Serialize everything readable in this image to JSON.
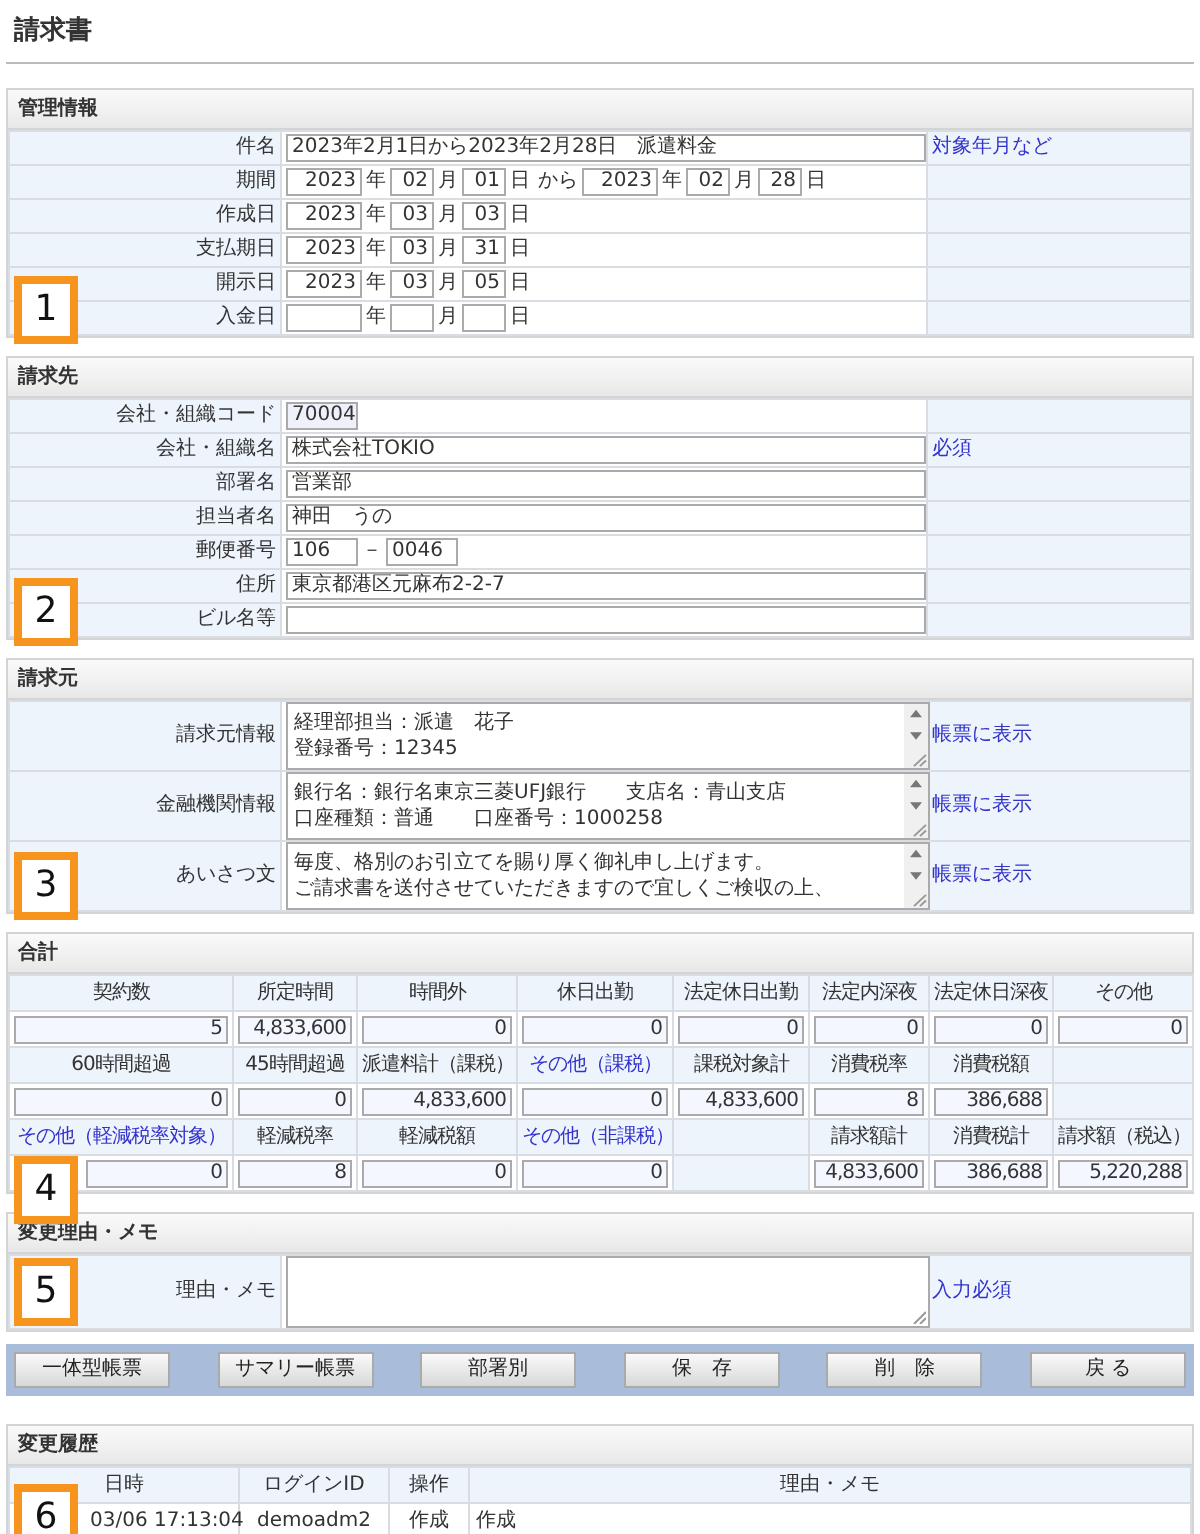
{
  "page_title": "請求書",
  "sections": [
    {
      "kind": "form",
      "heading": "管理情報",
      "callout": "1",
      "rows": [
        {
          "label": "件名",
          "fields": [
            {
              "kind": "wide",
              "value": "2023年2月1日から2023年2月28日　派遣料金"
            }
          ],
          "note": "対象年月など"
        },
        {
          "label": "期間",
          "fields": [
            {
              "kind": "year",
              "value": "2023"
            },
            {
              "kind": "unit",
              "text": "年"
            },
            {
              "kind": "short",
              "value": "02"
            },
            {
              "kind": "unit",
              "text": "月"
            },
            {
              "kind": "short",
              "value": "01"
            },
            {
              "kind": "unit",
              "text": "日"
            },
            {
              "kind": "unit",
              "text": "から"
            },
            {
              "kind": "year",
              "value": "2023"
            },
            {
              "kind": "unit",
              "text": "年"
            },
            {
              "kind": "short",
              "value": "02"
            },
            {
              "kind": "unit",
              "text": "月"
            },
            {
              "kind": "short",
              "value": "28"
            },
            {
              "kind": "unit",
              "text": "日"
            }
          ]
        },
        {
          "label": "作成日",
          "fields": [
            {
              "kind": "year",
              "value": "2023"
            },
            {
              "kind": "unit",
              "text": "年"
            },
            {
              "kind": "short",
              "value": "03"
            },
            {
              "kind": "unit",
              "text": "月"
            },
            {
              "kind": "short",
              "value": "03"
            },
            {
              "kind": "unit",
              "text": "日"
            }
          ]
        },
        {
          "label": "支払期日",
          "fields": [
            {
              "kind": "year",
              "value": "2023"
            },
            {
              "kind": "unit",
              "text": "年"
            },
            {
              "kind": "short",
              "value": "03"
            },
            {
              "kind": "unit",
              "text": "月"
            },
            {
              "kind": "short",
              "value": "31"
            },
            {
              "kind": "unit",
              "text": "日"
            }
          ]
        },
        {
          "label": "開示日",
          "fields": [
            {
              "kind": "year",
              "value": "2023"
            },
            {
              "kind": "unit",
              "text": "年"
            },
            {
              "kind": "short",
              "value": "03"
            },
            {
              "kind": "unit",
              "text": "月"
            },
            {
              "kind": "short",
              "value": "05"
            },
            {
              "kind": "unit",
              "text": "日"
            }
          ]
        },
        {
          "label": "入金日",
          "fields": [
            {
              "kind": "year"
            },
            {
              "kind": "unit",
              "text": "年"
            },
            {
              "kind": "short"
            },
            {
              "kind": "unit",
              "text": "月"
            },
            {
              "kind": "short"
            },
            {
              "kind": "unit",
              "text": "日"
            }
          ]
        }
      ]
    },
    {
      "kind": "form",
      "heading": "請求先",
      "callout": "2",
      "rows": [
        {
          "label": "会社・組織コード",
          "fields": [
            {
              "kind": "code",
              "value": "70004",
              "readonly": true
            }
          ]
        },
        {
          "label": "会社・組織名",
          "fields": [
            {
              "kind": "wide",
              "value": "株式会社TOKIO"
            }
          ],
          "note": "必須"
        },
        {
          "label": "部署名",
          "fields": [
            {
              "kind": "wide",
              "value": "営業部"
            }
          ]
        },
        {
          "label": "担当者名",
          "fields": [
            {
              "kind": "wide",
              "value": "神田　うの"
            }
          ]
        },
        {
          "label": "郵便番号",
          "fields": [
            {
              "kind": "code",
              "value": "106"
            },
            {
              "kind": "unit",
              "text": "－"
            },
            {
              "kind": "code",
              "value": "0046"
            }
          ]
        },
        {
          "label": "住所",
          "fields": [
            {
              "kind": "wide",
              "value": "東京都港区元麻布2-2-7"
            }
          ]
        },
        {
          "label": "ビル名等",
          "fields": [
            {
              "kind": "wide"
            }
          ]
        }
      ]
    },
    {
      "kind": "memo",
      "heading": "請求元",
      "callout": "3",
      "rows": [
        {
          "label": "請求元情報",
          "lines": [
            "経理部担当：派遣　花子",
            "登録番号：12345"
          ],
          "note": "帳票に表示"
        },
        {
          "label": "金融機関情報",
          "lines": [
            "銀行名：銀行名東京三菱UFJ銀行　　支店名：青山支店",
            "口座種類：普通　　口座番号：1000258"
          ],
          "note": "帳票に表示"
        },
        {
          "label": "あいさつ文",
          "lines": [
            "毎度、格別のお引立てを賜り厚く御礼申し上げます。",
            "ご請求書を送付させていただきますので宜しくご検収の上、"
          ],
          "note": "帳票に表示"
        }
      ]
    },
    {
      "kind": "totals",
      "heading": "合計",
      "callout": "4",
      "rows": [
        [
          {
            "kind": "label",
            "text": "契約数"
          },
          {
            "kind": "label",
            "text": "所定時間"
          },
          {
            "kind": "label",
            "text": "時間外"
          },
          {
            "kind": "label",
            "text": "休日出勤"
          },
          {
            "kind": "label",
            "text": "法定休日出勤"
          },
          {
            "kind": "label",
            "text": "法定内深夜"
          },
          {
            "kind": "label",
            "text": "法定休日深夜"
          },
          {
            "kind": "label",
            "text": "その他"
          }
        ],
        [
          {
            "kind": "input",
            "value": "5"
          },
          {
            "kind": "input",
            "value": "4,833,600"
          },
          {
            "kind": "input",
            "value": "0"
          },
          {
            "kind": "input",
            "value": "0"
          },
          {
            "kind": "input",
            "value": "0"
          },
          {
            "kind": "input",
            "value": "0"
          },
          {
            "kind": "input",
            "value": "0"
          },
          {
            "kind": "input",
            "value": "0"
          }
        ],
        [
          {
            "kind": "label",
            "text": "60時間超過"
          },
          {
            "kind": "label",
            "text": "45時間超過"
          },
          {
            "kind": "label",
            "text": "派遣料計（課税）"
          },
          {
            "kind": "link",
            "text": "その他（課税）"
          },
          {
            "kind": "label",
            "text": "課税対象計"
          },
          {
            "kind": "label",
            "text": "消費税率"
          },
          {
            "kind": "label",
            "text": "消費税額"
          },
          {
            "kind": "blank"
          }
        ],
        [
          {
            "kind": "input",
            "value": "0"
          },
          {
            "kind": "input",
            "value": "0"
          },
          {
            "kind": "input",
            "value": "4,833,600"
          },
          {
            "kind": "input",
            "value": "0"
          },
          {
            "kind": "input",
            "value": "4,833,600"
          },
          {
            "kind": "input",
            "value": "8"
          },
          {
            "kind": "input",
            "value": "386,688"
          },
          {
            "kind": "blank"
          }
        ],
        [
          {
            "kind": "link",
            "text": "その他（軽減税率対象）"
          },
          {
            "kind": "label",
            "text": "軽減税率"
          },
          {
            "kind": "label",
            "text": "軽減税額"
          },
          {
            "kind": "link",
            "text": "その他（非課税）"
          },
          {
            "kind": "blank"
          },
          {
            "kind": "label",
            "text": "請求額計"
          },
          {
            "kind": "label",
            "text": "消費税計"
          },
          {
            "kind": "label",
            "text": "請求額（税込）"
          }
        ],
        [
          {
            "kind": "input",
            "value": "0"
          },
          {
            "kind": "input",
            "value": "8"
          },
          {
            "kind": "input",
            "value": "0"
          },
          {
            "kind": "input",
            "value": "0"
          },
          {
            "kind": "blank"
          },
          {
            "kind": "input",
            "value": "4,833,600"
          },
          {
            "kind": "input",
            "value": "386,688"
          },
          {
            "kind": "input",
            "value": "5,220,288"
          }
        ]
      ]
    },
    {
      "kind": "reason",
      "heading": "変更理由・メモ",
      "callout": "5",
      "label": "理由・メモ",
      "note": "入力必須"
    },
    {
      "kind": "buttons",
      "buttons": [
        "一体型帳票",
        "サマリー帳票",
        "部署別",
        "保　存",
        "削　除",
        "戻 る"
      ]
    },
    {
      "kind": "history",
      "heading": "変更履歴",
      "callout": "6",
      "columns": [
        "日時",
        "ログインID",
        "操作",
        "理由・メモ"
      ],
      "rows": [
        [
          "03/06 17:13:04",
          "demoadm2",
          "作成",
          "作成"
        ]
      ]
    }
  ]
}
